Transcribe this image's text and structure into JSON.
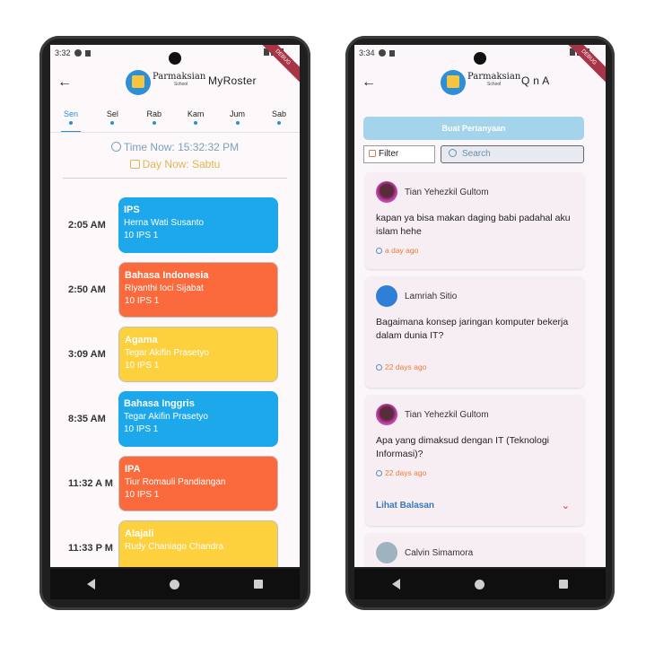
{
  "left": {
    "status": {
      "time": "3:32"
    },
    "brand": {
      "name": "Parmaksian",
      "sub": "School"
    },
    "title": "MyRoster",
    "days": [
      {
        "label": "Sen",
        "active": true
      },
      {
        "label": "Sel",
        "active": false
      },
      {
        "label": "Rab",
        "active": false
      },
      {
        "label": "Kam",
        "active": false
      },
      {
        "label": "Jum",
        "active": false
      },
      {
        "label": "Sab",
        "active": false
      }
    ],
    "time_now": "Time Now: 15:32:32 PM",
    "day_now": "Day Now: Sabtu",
    "schedule": [
      {
        "time": "2:05 AM",
        "subject": "IPS",
        "teacher": "Herna Wati Susanto",
        "class": "10 IPS 1",
        "color": "blue"
      },
      {
        "time": "2:50 AM",
        "subject": "Bahasa Indonesia",
        "teacher": "Riyanthi Ioci Sijabat",
        "class": "10 IPS 1",
        "color": "orange"
      },
      {
        "time": "3:09 AM",
        "subject": "Agama",
        "teacher": "Tegar Akifin Prasetyo",
        "class": "10 IPS 1",
        "color": "yellow"
      },
      {
        "time": "8:35 AM",
        "subject": "Bahasa Inggris",
        "teacher": "Tegar Akifin Prasetyo",
        "class": "10 IPS 1",
        "color": "blue"
      },
      {
        "time": "11:32 A M",
        "subject": "IPA",
        "teacher": "Tiur Romauli Pandiangan",
        "class": "10 IPS 1",
        "color": "orange"
      },
      {
        "time": "11:33 P M",
        "subject": "Alajali",
        "teacher": "Rudy Chaniago Chandra",
        "class": "",
        "color": "yellow"
      }
    ],
    "debug_label": "DEBUG"
  },
  "right": {
    "status": {
      "time": "3:34"
    },
    "brand": {
      "name": "Parmaksian",
      "sub": "School"
    },
    "title": "Q n A",
    "ask_button": "Buat Pertanyaan",
    "filter_label": "Filter",
    "search_placeholder": "Search",
    "questions": [
      {
        "user": "Tian Yehezkil Gultom",
        "text": "kapan ya bisa makan daging babi padahal aku islam hehe",
        "time": "a day ago",
        "avatar": "purple"
      },
      {
        "user": "Lamriah  Sitio",
        "text": "Bagaimana konsep jaringan komputer bekerja dalam dunia IT?",
        "time": "22 days ago",
        "avatar": "game"
      },
      {
        "user": "Tian Yehezkil Gultom",
        "text": "Apa yang dimaksud dengan IT (Teknologi Informasi)?",
        "time": "22 days ago",
        "avatar": "purple",
        "replies_label": "Lihat Balasan"
      },
      {
        "user": "Calvin Simamora",
        "text": "",
        "time": "",
        "avatar": "grey"
      }
    ],
    "debug_label": "DEBUG"
  },
  "colors": {
    "accent": "#2b8fd6",
    "blue_card": "#1ea8ec",
    "orange_card": "#fb6a3c",
    "yellow_card": "#fdd03e",
    "ask_button": "#a3d4ec"
  }
}
